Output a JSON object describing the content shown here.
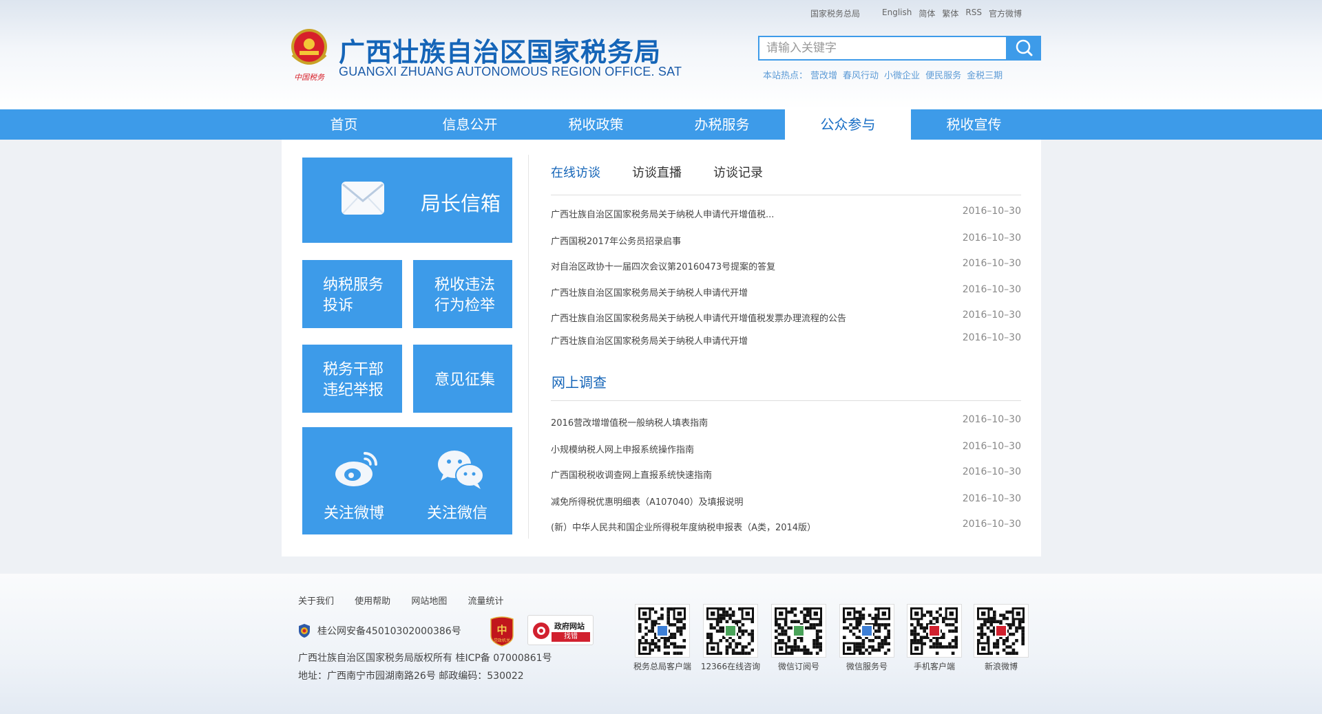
{
  "header": {
    "toplinks": [
      "国家税务总局",
      "English",
      "简体",
      "繁体",
      "RSS",
      "官方微博"
    ],
    "title": "广西壮族自治区国家税务局",
    "subtitle": "GUANGXI ZHUANG AUTONOMOUS REGION OFFICE. SAT",
    "emblem_text": "中国税务",
    "search_placeholder": "请输入关键字",
    "hot_label": "本站热点：",
    "hot_words": [
      "营改增",
      "春风行动",
      "小微企业",
      "便民服务",
      "金税三期"
    ]
  },
  "nav": {
    "items": [
      "首页",
      "信息公开",
      "税收政策",
      "办税服务",
      "公众参与",
      "税收宣传"
    ],
    "active_index": 4
  },
  "tiles": {
    "mailbox": "局长信箱",
    "complaint": [
      "纳税服务",
      "投诉"
    ],
    "report": [
      "税收违法",
      "行为检举"
    ],
    "discipline": [
      "税务干部",
      "违纪举报"
    ],
    "opinion": "意见征集",
    "weibo": "关注微博",
    "wechat": "关注微信"
  },
  "tabs": [
    "在线访谈",
    "访谈直播",
    "访谈记录"
  ],
  "interviews": [
    {
      "title": "广西壮族自治区国家税务局关于纳税人申请代开增值税...",
      "date": "2016–10–30"
    },
    {
      "title": "广西国税2017年公务员招录启事",
      "date": "2016–10–30"
    },
    {
      "title": "对自治区政协十一届四次会议第20160473号提案的答复",
      "date": "2016–10–30"
    },
    {
      "title": "广西壮族自治区国家税务局关于纳税人申请代开增",
      "date": "2016–10–30"
    },
    {
      "title": "广西壮族自治区国家税务局关于纳税人申请代开增值税发票办理流程的公告",
      "date": "2016–10–30"
    },
    {
      "title": "广西壮族自治区国家税务局关于纳税人申请代开增",
      "date": "2016–10–30"
    }
  ],
  "survey_title": "网上调查",
  "surveys": [
    {
      "title": "2016营改增增值税一般纳税人填表指南",
      "date": "2016–10–30"
    },
    {
      "title": "小规模纳税人网上申报系统操作指南",
      "date": "2016–10–30"
    },
    {
      "title": "广西国税税收调查网上直报系统快速指南",
      "date": "2016–10–30"
    },
    {
      "title": "减免所得税优惠明细表（A107040）及填报说明",
      "date": "2016–10–30"
    },
    {
      "title": "(新）中华人民共和国企业所得税年度纳税申报表（A类，2014版）",
      "date": "2016–10–30"
    }
  ],
  "footer": {
    "links": [
      "关于我们",
      "使用帮助",
      "网站地图",
      "流量统计"
    ],
    "police": "桂公网安备45010302000386号",
    "party_badge": "党政机关",
    "gov_badge_top": "政府网站",
    "gov_badge_bottom": "找错",
    "copyright": "广西壮族自治区国家税务局版权所有 桂ICP备 07000861号",
    "address": "地址：广西南宁市园湖南路26号 邮政编码：530022",
    "qrcodes": [
      "税务总局客户端",
      "12366在线咨询",
      "微信订阅号",
      "微信服务号",
      "手机客户端",
      "新浪微博"
    ]
  },
  "colors": {
    "accent": "#3d9be9",
    "title_blue": "#1565b8"
  }
}
